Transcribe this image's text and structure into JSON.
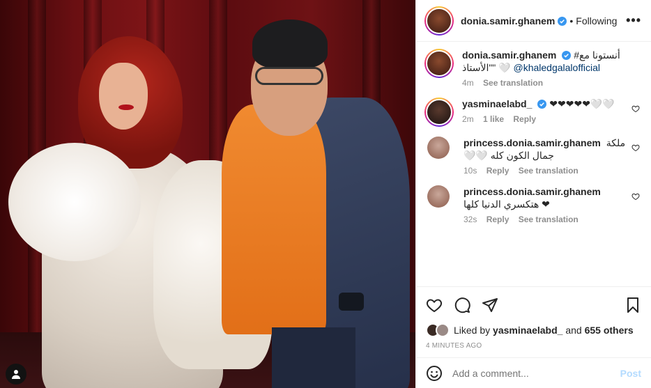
{
  "header": {
    "username": "donia.samir.ghanem",
    "separator": "•",
    "follow_label": "Following",
    "more_label": "•••"
  },
  "caption": {
    "username": "donia.samir.ghanem",
    "text": "أنستونا مع# \"\"الأستاذ 🤍",
    "mention": "@khaledgalalofficial",
    "time": "4m",
    "translate": "See translation"
  },
  "comments": [
    {
      "username": "yasminaelabd_",
      "text": "❤❤❤❤❤🤍🤍",
      "time": "2m",
      "likes": "1 like",
      "reply": "Reply"
    },
    {
      "username": "princess.donia.samir.ghanem",
      "text": "ملكة",
      "text2": "🤍🤍 جمال الكون كله",
      "time": "10s",
      "reply": "Reply",
      "translate": "See translation"
    },
    {
      "username": "princess.donia.samir.ghanem",
      "text": "",
      "text2": "هتكسري الدنيا كلها ❤",
      "time": "32s",
      "reply": "Reply",
      "translate": "See translation"
    }
  ],
  "likes": {
    "prefix": "Liked by",
    "user": "yasminaelabd_",
    "and": "and",
    "others": "655 others"
  },
  "timestamp": "4 MINUTES AGO",
  "add_comment": {
    "placeholder": "Add a comment...",
    "post_label": "Post"
  },
  "colors": {
    "verified": "#3897f0",
    "link": "#00376b",
    "muted": "#8e8e8e",
    "post_disabled": "#b3dbff",
    "jacket": "#2f3a58",
    "shirt": "#e87a22",
    "curtain": "#6a0f12"
  },
  "icons": [
    "user-tag-icon",
    "verified-icon",
    "more-icon",
    "heart-icon",
    "comment-icon",
    "share-icon",
    "bookmark-icon",
    "emoji-icon"
  ]
}
